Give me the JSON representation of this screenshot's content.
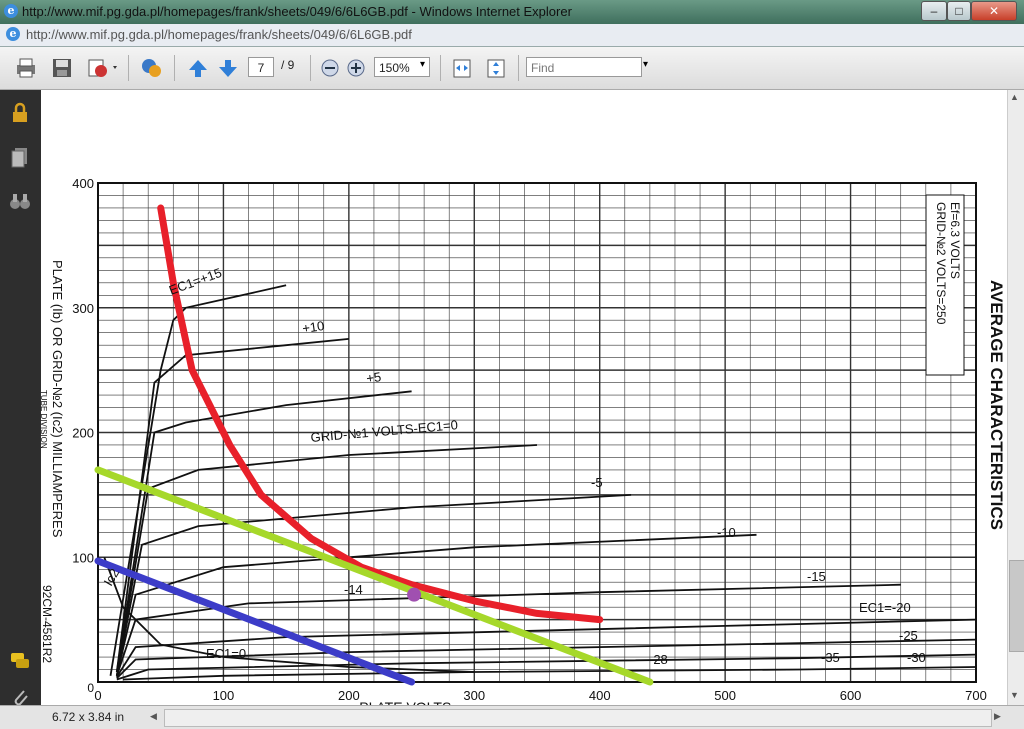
{
  "window": {
    "title": "http://www.mif.pg.gda.pl/homepages/frank/sheets/049/6/6L6GB.pdf - Windows Internet Explorer",
    "minimize": "–",
    "maximize": "□",
    "close": "✕"
  },
  "address_bar": {
    "url": "http://www.mif.pg.gda.pl/homepages/frank/sheets/049/6/6L6GB.pdf"
  },
  "toolbar": {
    "page_current": "7",
    "page_total": "/ 9",
    "zoom": "150%",
    "find_placeholder": "Find",
    "icons": [
      "print-icon",
      "save-icon",
      "sign-icon",
      "collaborate-icon",
      "previous-page-icon",
      "next-page-icon",
      "zoom-out-icon",
      "zoom-in-icon",
      "fit-width-icon",
      "fit-page-icon",
      "find-dropdown-icon"
    ]
  },
  "left_panel": {
    "icons": [
      "lock-icon",
      "pages-icon",
      "binoculars-icon",
      "comment-icon",
      "attachment-icon"
    ]
  },
  "status": {
    "page_size": "6.72 x 3.84 in"
  },
  "chart_data": {
    "type": "line",
    "title": "AVERAGE CHARACTERISTICS",
    "xlabel": "PLATE  VOLTS",
    "ylabel": "PLATE (Ib) OR GRID-№2 (Ic2) MILLIAMPERES",
    "xlim": [
      0,
      700
    ],
    "ylim": [
      0,
      400
    ],
    "x_ticks": [
      "0",
      "100",
      "200",
      "300",
      "400",
      "500",
      "600",
      "700"
    ],
    "y_ticks": [
      "100",
      "200",
      "300",
      "400"
    ],
    "conditions": [
      "Ef=6.3 VOLTS",
      "GRID-№2 VOLTS=250"
    ],
    "doc_codes": [
      "92CM-4581R2",
      "TUBE DIVISION"
    ],
    "curve_labels": [
      "EC1=+15",
      "+10",
      "+5",
      "GRID-№1 VOLTS-EC1=0",
      "-5",
      "-10",
      "-14",
      "-15",
      "EC1=-20",
      "-25",
      "-28",
      "-30",
      "-35",
      "Ic2",
      "EC1=0"
    ],
    "grid": true,
    "series": [
      {
        "key": "ec1_p15",
        "x": [
          10,
          50,
          60,
          70,
          150
        ],
        "y": [
          5,
          250,
          290,
          300,
          318
        ]
      },
      {
        "key": "ec1_p10",
        "x": [
          15,
          45,
          70,
          150,
          200
        ],
        "y": [
          8,
          240,
          262,
          270,
          275
        ]
      },
      {
        "key": "ec1_p5",
        "x": [
          15,
          45,
          70,
          150,
          250
        ],
        "y": [
          8,
          200,
          208,
          222,
          233
        ]
      },
      {
        "key": "ec1_0",
        "x": [
          15,
          40,
          80,
          200,
          350
        ],
        "y": [
          5,
          155,
          170,
          182,
          190
        ]
      },
      {
        "key": "ec1_m5",
        "x": [
          15,
          35,
          80,
          250,
          425
        ],
        "y": [
          5,
          110,
          125,
          140,
          150
        ]
      },
      {
        "key": "ec1_m10",
        "x": [
          15,
          30,
          100,
          300,
          525
        ],
        "y": [
          5,
          70,
          92,
          108,
          118
        ]
      },
      {
        "key": "ec1_m15",
        "x": [
          15,
          30,
          120,
          400,
          640
        ],
        "y": [
          5,
          50,
          63,
          72,
          78
        ]
      },
      {
        "key": "ec1_m20",
        "x": [
          15,
          30,
          150,
          500,
          700
        ],
        "y": [
          4,
          28,
          36,
          45,
          50
        ]
      },
      {
        "key": "ec1_m25",
        "x": [
          15,
          30,
          200,
          500,
          700
        ],
        "y": [
          3,
          18,
          24,
          30,
          34
        ]
      },
      {
        "key": "ec1_m30",
        "x": [
          15,
          40,
          250,
          550,
          700
        ],
        "y": [
          2,
          10,
          15,
          19,
          22
        ]
      },
      {
        "key": "ec1_m35",
        "x": [
          20,
          100,
          300,
          560,
          700
        ],
        "y": [
          2,
          5,
          8,
          10,
          12
        ]
      },
      {
        "key": "ic2_ec1_0",
        "x": [
          5,
          20,
          50,
          100,
          200,
          300
        ],
        "y": [
          100,
          60,
          30,
          20,
          12,
          8
        ]
      },
      {
        "key": "red_overlay",
        "x": [
          50,
          60,
          75,
          105,
          130,
          170,
          210,
          250,
          300,
          350,
          400
        ],
        "y": [
          380,
          320,
          250,
          190,
          150,
          115,
          92,
          78,
          65,
          55,
          50
        ]
      },
      {
        "key": "green_load_line",
        "x": [
          0,
          440
        ],
        "y": [
          170,
          0
        ]
      },
      {
        "key": "blue_load_line",
        "x": [
          0,
          250
        ],
        "y": [
          97,
          0
        ]
      },
      {
        "key": "operating_point",
        "x": [
          252
        ],
        "y": [
          70
        ]
      }
    ],
    "colors": {
      "red_overlay": "#e8202a",
      "green_load_line": "#a6d82a",
      "blue_load_line": "#3c3cc8",
      "operating_point": "#a050b0"
    }
  }
}
